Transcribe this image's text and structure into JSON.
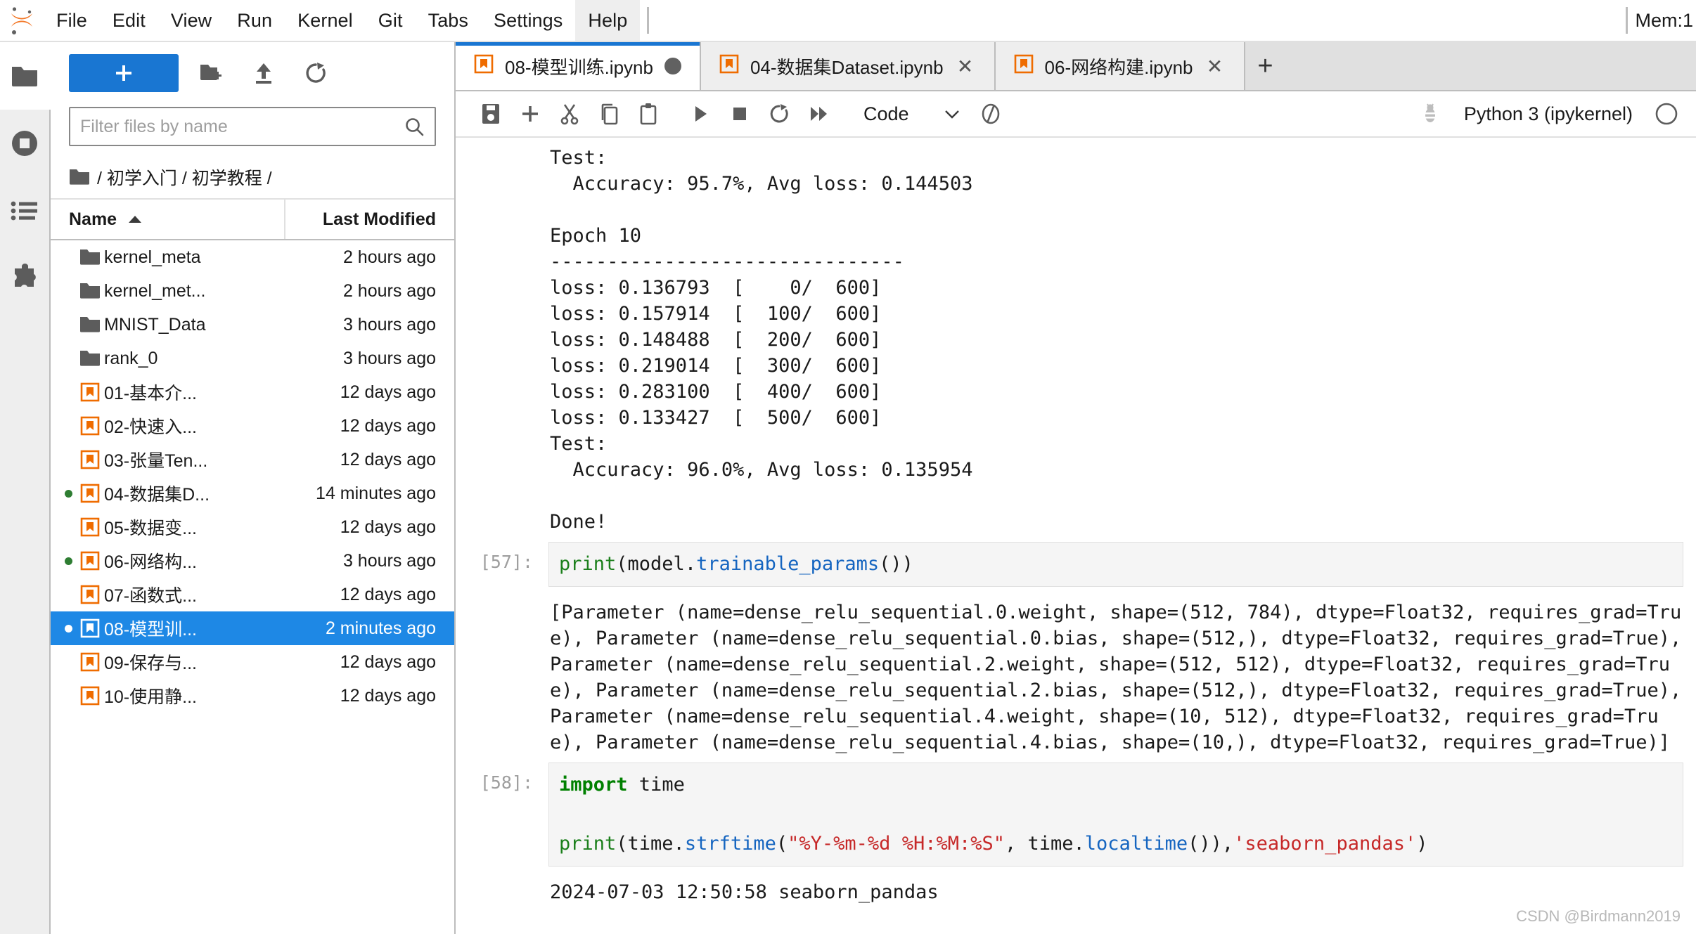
{
  "menubar": {
    "items": [
      "File",
      "Edit",
      "View",
      "Run",
      "Kernel",
      "Git",
      "Tabs",
      "Settings",
      "Help"
    ],
    "active_item": "Help",
    "memory_label": "Mem:1",
    "logo_icon": "jupyter-logo-icon"
  },
  "activitybar": {
    "items": [
      {
        "icon": "folder-icon",
        "name": "file-browser",
        "selected": true
      },
      {
        "icon": "running-sessions-icon",
        "name": "running-terminals-kernels",
        "selected": false
      },
      {
        "icon": "table-of-contents-icon",
        "name": "table-of-contents",
        "selected": false
      },
      {
        "icon": "puzzle-piece-icon",
        "name": "extension-manager",
        "selected": false
      }
    ]
  },
  "filebrowser": {
    "new_launcher_label": "+",
    "toolbar_icons": [
      "new-folder-icon",
      "upload-icon",
      "refresh-icon"
    ],
    "filter": {
      "placeholder": "Filter files by name",
      "value": "",
      "icon": "search-icon"
    },
    "breadcrumb": "/ 初学入门 / 初学教程 /",
    "breadcrumb_icon": "folder-icon",
    "columns": {
      "name": "Name",
      "last_modified": "Last Modified"
    },
    "sort_indicator": "ascending-caret-icon",
    "items": [
      {
        "name": "kernel_meta",
        "modified": "2 hours ago",
        "type": "folder",
        "running": false,
        "selected": false
      },
      {
        "name": "kernel_met...",
        "modified": "2 hours ago",
        "type": "folder",
        "running": false,
        "selected": false
      },
      {
        "name": "MNIST_Data",
        "modified": "3 hours ago",
        "type": "folder",
        "running": false,
        "selected": false
      },
      {
        "name": "rank_0",
        "modified": "3 hours ago",
        "type": "folder",
        "running": false,
        "selected": false
      },
      {
        "name": "01-基本介...",
        "modified": "12 days ago",
        "type": "notebook",
        "running": false,
        "selected": false
      },
      {
        "name": "02-快速入...",
        "modified": "12 days ago",
        "type": "notebook",
        "running": false,
        "selected": false
      },
      {
        "name": "03-张量Ten...",
        "modified": "12 days ago",
        "type": "notebook",
        "running": false,
        "selected": false
      },
      {
        "name": "04-数据集D...",
        "modified": "14 minutes ago",
        "type": "notebook",
        "running": true,
        "selected": false
      },
      {
        "name": "05-数据变...",
        "modified": "12 days ago",
        "type": "notebook",
        "running": false,
        "selected": false
      },
      {
        "name": "06-网络构...",
        "modified": "3 hours ago",
        "type": "notebook",
        "running": true,
        "selected": false
      },
      {
        "name": "07-函数式...",
        "modified": "12 days ago",
        "type": "notebook",
        "running": false,
        "selected": false
      },
      {
        "name": "08-模型训...",
        "modified": "2 minutes ago",
        "type": "notebook",
        "running": true,
        "selected": true
      },
      {
        "name": "09-保存与...",
        "modified": "12 days ago",
        "type": "notebook",
        "running": false,
        "selected": false
      },
      {
        "name": "10-使用静...",
        "modified": "12 days ago",
        "type": "notebook",
        "running": false,
        "selected": false
      }
    ]
  },
  "tabs": [
    {
      "label": "08-模型训练.ipynb",
      "active": true,
      "dirty": true,
      "close": ""
    },
    {
      "label": "04-数据集Dataset.ipynb",
      "active": false,
      "dirty": false,
      "close": "✕"
    },
    {
      "label": "06-网络构建.ipynb",
      "active": false,
      "dirty": false,
      "close": "✕"
    }
  ],
  "tab_add_label": "+",
  "notebook_toolbar": {
    "buttons": [
      "save-icon",
      "insert-cell-icon",
      "cut-icon",
      "copy-icon",
      "paste-icon",
      "run-icon",
      "stop-icon",
      "restart-kernel-icon",
      "restart-run-all-icon"
    ],
    "cell_type": "Code",
    "cell_type_caret": "chevron-down-icon",
    "extra_icon": "mindspore-icon",
    "debugger_icon": "bug-icon",
    "kernel_name": "Python 3 (ipykernel)",
    "kernel_status_icon": "kernel-idle-circle-icon"
  },
  "notebook": {
    "scrolled_output_top": "Test:\n  Accuracy: 95.7%, Avg loss: 0.144503\n\nEpoch 10\n-------------------------------\nloss: 0.136793  [    0/  600]\nloss: 0.157914  [  100/  600]\nloss: 0.148488  [  200/  600]\nloss: 0.219014  [  300/  600]\nloss: 0.283100  [  400/  600]\nloss: 0.133427  [  500/  600]\nTest:\n  Accuracy: 96.0%, Avg loss: 0.135954\n\nDone!",
    "cells": [
      {
        "prompt": "[57]:",
        "code_plain": "print(model.trainable_params())",
        "code_tokens": [
          {
            "t": "print",
            "c": "tok-green"
          },
          {
            "t": "(model.",
            "c": ""
          },
          {
            "t": "trainable_params",
            "c": "tok-blue"
          },
          {
            "t": "())",
            "c": ""
          }
        ],
        "output": "[Parameter (name=dense_relu_sequential.0.weight, shape=(512, 784), dtype=Float32, requires_grad=True), Parameter (name=dense_relu_sequential.0.bias, shape=(512,), dtype=Float32, requires_grad=True), Parameter (name=dense_relu_sequential.2.weight, shape=(512, 512), dtype=Float32, requires_grad=True), Parameter (name=dense_relu_sequential.2.bias, shape=(512,), dtype=Float32, requires_grad=True), Parameter (name=dense_relu_sequential.4.weight, shape=(10, 512), dtype=Float32, requires_grad=True), Parameter (name=dense_relu_sequential.4.bias, shape=(10,), dtype=Float32, requires_grad=True)]"
      },
      {
        "prompt": "[58]:",
        "code_tokens_line1": [
          {
            "t": "import",
            "c": "tok-kw"
          },
          {
            "t": " time",
            "c": ""
          }
        ],
        "code_tokens_line3": [
          {
            "t": "print",
            "c": "tok-green"
          },
          {
            "t": "(time.",
            "c": ""
          },
          {
            "t": "strftime",
            "c": "tok-blue"
          },
          {
            "t": "(",
            "c": ""
          },
          {
            "t": "\"%Y-%m-%d %H:%M:%S\"",
            "c": "tok-str"
          },
          {
            "t": ", time.",
            "c": ""
          },
          {
            "t": "localtime",
            "c": "tok-blue"
          },
          {
            "t": "()),",
            "c": ""
          },
          {
            "t": "'seaborn_pandas'",
            "c": "tok-str"
          },
          {
            "t": ")",
            "c": ""
          }
        ],
        "output": "2024-07-03 12:50:58 seaborn_pandas"
      }
    ]
  },
  "watermark": "CSDN @Birdmann2019",
  "colors": {
    "accent_blue": "#1976d2",
    "selection_blue": "#1e88e5",
    "notebook_orange": "#ef6c00",
    "running_green": "#2e7d32"
  }
}
